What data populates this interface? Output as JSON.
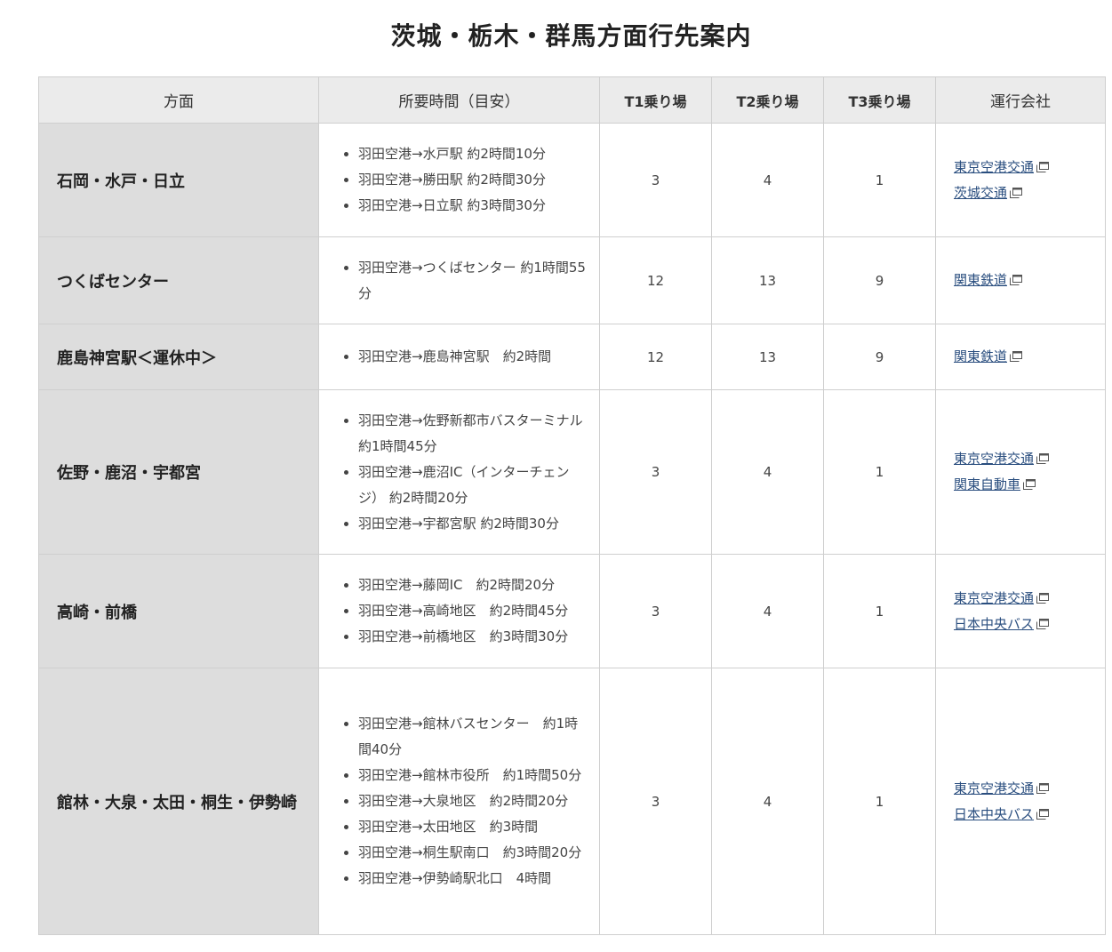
{
  "title": "茨城・栃木・群馬方面行先案内",
  "headers": {
    "direction": "方面",
    "time": "所要時間（目安）",
    "t1": "T1乗り場",
    "t2": "T2乗り場",
    "t3": "T3乗り場",
    "company": "運行会社"
  },
  "rows": [
    {
      "direction": "石岡・水戸・日立",
      "times": [
        "羽田空港→水戸駅 約2時間10分",
        "羽田空港→勝田駅 約2時間30分",
        "羽田空港→日立駅 約3時間30分"
      ],
      "t1": "3",
      "t2": "4",
      "t3": "1",
      "companies": [
        "東京空港交通",
        "茨城交通"
      ]
    },
    {
      "direction": "つくばセンター",
      "times": [
        "羽田空港→つくばセンター 約1時間55分"
      ],
      "t1": "12",
      "t2": "13",
      "t3": "9",
      "companies": [
        "関東鉄道"
      ]
    },
    {
      "direction": "鹿島神宮駅＜運休中＞",
      "times": [
        "羽田空港→鹿島神宮駅　約2時間"
      ],
      "t1": "12",
      "t2": "13",
      "t3": "9",
      "companies": [
        "関東鉄道"
      ]
    },
    {
      "direction": "佐野・鹿沼・宇都宮",
      "times": [
        "羽田空港→佐野新都市バスターミナル 約1時間45分",
        "羽田空港→鹿沼IC（インターチェンジ） 約2時間20分",
        "羽田空港→宇都宮駅 約2時間30分"
      ],
      "t1": "3",
      "t2": "4",
      "t3": "1",
      "companies": [
        "東京空港交通",
        "関東自動車"
      ]
    },
    {
      "direction": "高崎・前橋",
      "times": [
        "羽田空港→藤岡IC　約2時間20分",
        "羽田空港→高崎地区　約2時間45分",
        "羽田空港→前橋地区　約3時間30分"
      ],
      "t1": "3",
      "t2": "4",
      "t3": "1",
      "companies": [
        "東京空港交通",
        "日本中央バス"
      ]
    },
    {
      "direction": "館林・大泉・太田・桐生・伊勢崎",
      "times": [
        "羽田空港→館林バスセンター　約1時間40分",
        "羽田空港→館林市役所　約1時間50分",
        "羽田空港→大泉地区　約2時間20分",
        "羽田空港→太田地区　約3時間",
        "羽田空港→桐生駅南口　約3時間20分",
        "羽田空港→伊勢崎駅北口　4時間"
      ],
      "t1": "3",
      "t2": "4",
      "t3": "1",
      "companies": [
        "東京空港交通",
        "日本中央バス"
      ]
    }
  ],
  "icons": {
    "link": "external-link-icon"
  },
  "colors": {
    "header_bg": "#ebebeb",
    "direction_bg": "#dddddd",
    "link": "#2a4e7f",
    "border": "#cfcfcf"
  }
}
